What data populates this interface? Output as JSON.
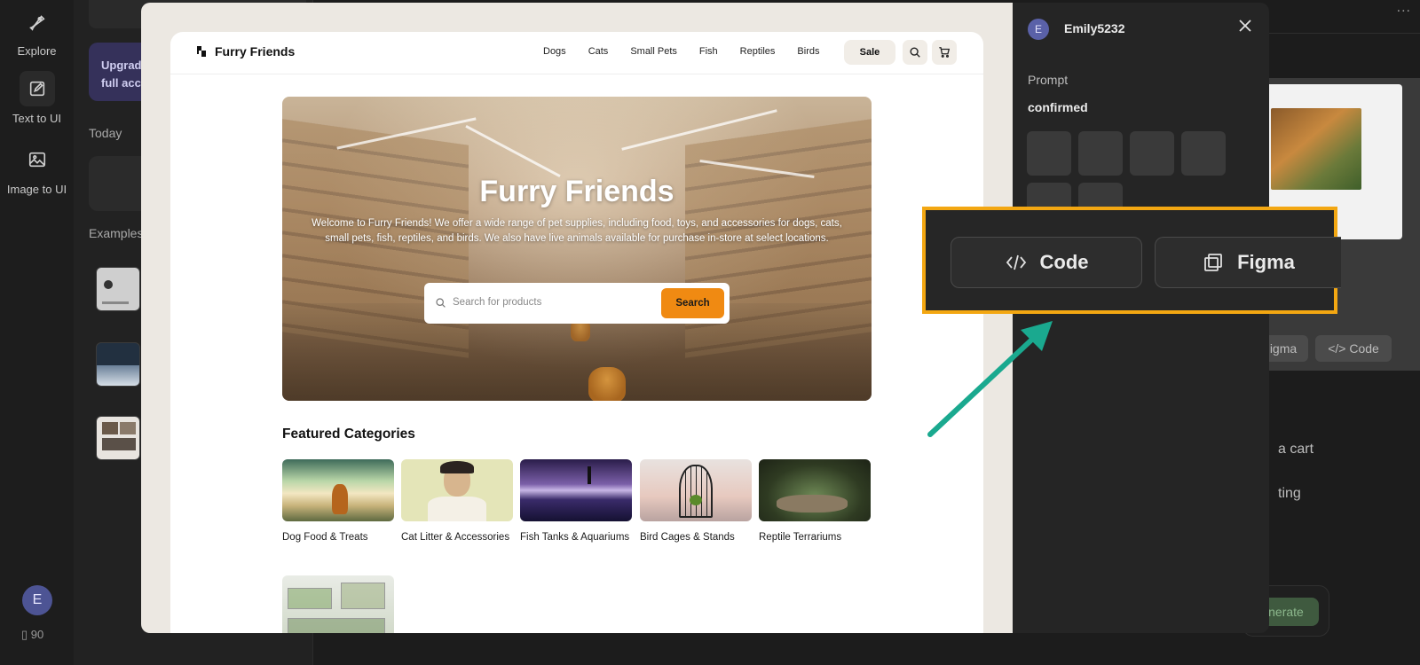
{
  "rail": {
    "items": [
      {
        "label": "Explore",
        "icon": "explore-icon"
      },
      {
        "label": "Text to UI",
        "icon": "edit-icon"
      },
      {
        "label": "Image to UI",
        "icon": "image-icon"
      }
    ],
    "avatar_initial": "E",
    "credits": "90"
  },
  "sidebar": {
    "upgrade_line1": "Upgrad",
    "upgrade_line2": "full acce",
    "today_label": "Today",
    "examples_label": "Examples"
  },
  "background": {
    "figma_label": "igma",
    "code_label": "Code",
    "text1": "a cart",
    "text2": "ting",
    "generate_label": "nerate",
    "dots": "..."
  },
  "site": {
    "brand": "Furry Friends",
    "nav": [
      "Dogs",
      "Cats",
      "Small Pets",
      "Fish",
      "Reptiles",
      "Birds"
    ],
    "sale_label": "Sale",
    "hero": {
      "title": "Furry Friends",
      "description": "Welcome to Furry Friends! We offer a wide range of pet supplies, including food, toys, and accessories for dogs, cats, small pets, fish, reptiles, and birds. We also have live animals available for purchase in-store at select locations.",
      "search_placeholder": "Search for products",
      "search_button": "Search"
    },
    "featured_title": "Featured Categories",
    "categories": [
      {
        "label": "Dog Food & Treats"
      },
      {
        "label": "Cat Litter & Accessories"
      },
      {
        "label": "Fish Tanks & Aquariums"
      },
      {
        "label": "Bird Cages & Stands"
      },
      {
        "label": "Reptile Terrariums"
      }
    ]
  },
  "panel": {
    "avatar_initial": "E",
    "username": "Emily5232",
    "prompt_label": "Prompt",
    "prompt_value": "confirmed"
  },
  "export": {
    "code_label": "Code",
    "figma_label": "Figma"
  },
  "colors": {
    "accent_orange": "#f08a12",
    "highlight": "#f3a712",
    "arrow": "#1aa98f"
  }
}
